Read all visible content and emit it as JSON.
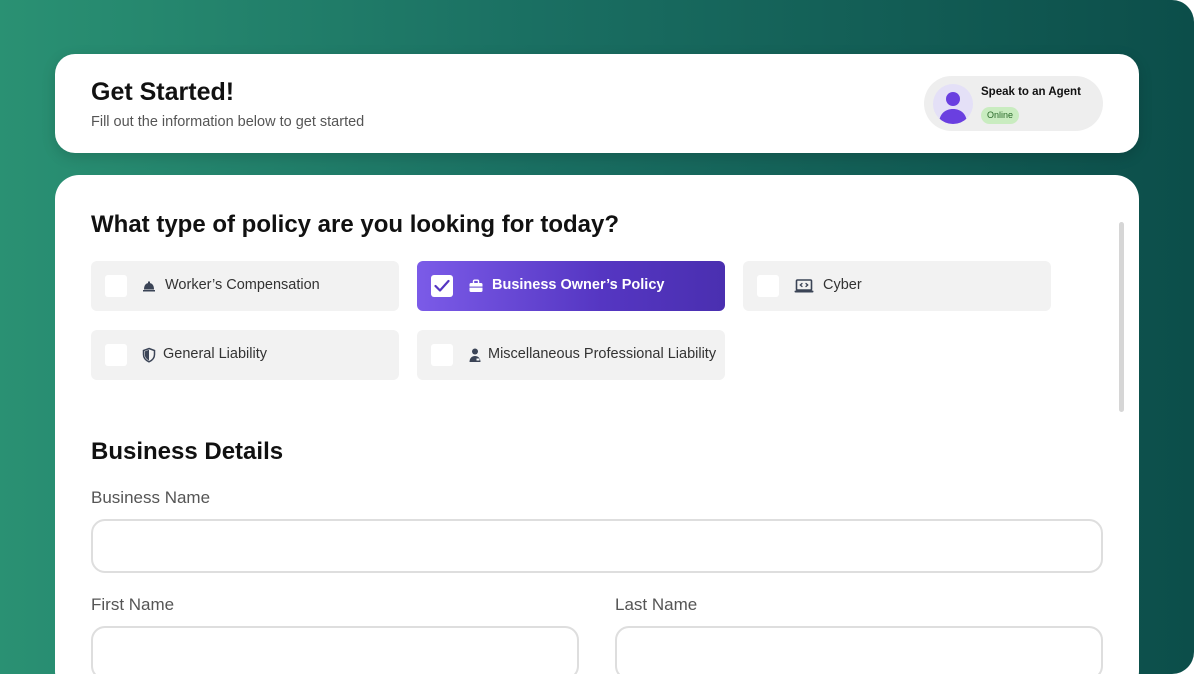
{
  "header": {
    "title": "Get Started!",
    "subtitle": "Fill out the information below to get started"
  },
  "agent": {
    "label": "Speak to an Agent",
    "status": "Online",
    "avatar_icon": "user-icon"
  },
  "policy": {
    "question": "What type of policy are you looking for today?",
    "options": [
      {
        "label": "Worker’s Compensation",
        "icon": "hard-hat-icon",
        "selected": false
      },
      {
        "label": "Business Owner’s Policy",
        "icon": "briefcase-icon",
        "selected": true
      },
      {
        "label": "Cyber",
        "icon": "laptop-code-icon",
        "selected": false
      },
      {
        "label": "General Liability",
        "icon": "shield-icon",
        "selected": false
      },
      {
        "label": "Miscellaneous Professional Liability",
        "icon": "professional-user-icon",
        "selected": false
      }
    ]
  },
  "business": {
    "heading": "Business Details",
    "business_name_label": "Business Name",
    "business_name_value": "",
    "first_name_label": "First Name",
    "first_name_value": "",
    "last_name_label": "Last Name",
    "last_name_value": ""
  },
  "colors": {
    "accent": "#5536c2",
    "accent_light": "#7b5be8",
    "background_start": "#2a9173",
    "background_end": "#0c4e4a",
    "online_badge": "#c9ecc0"
  }
}
